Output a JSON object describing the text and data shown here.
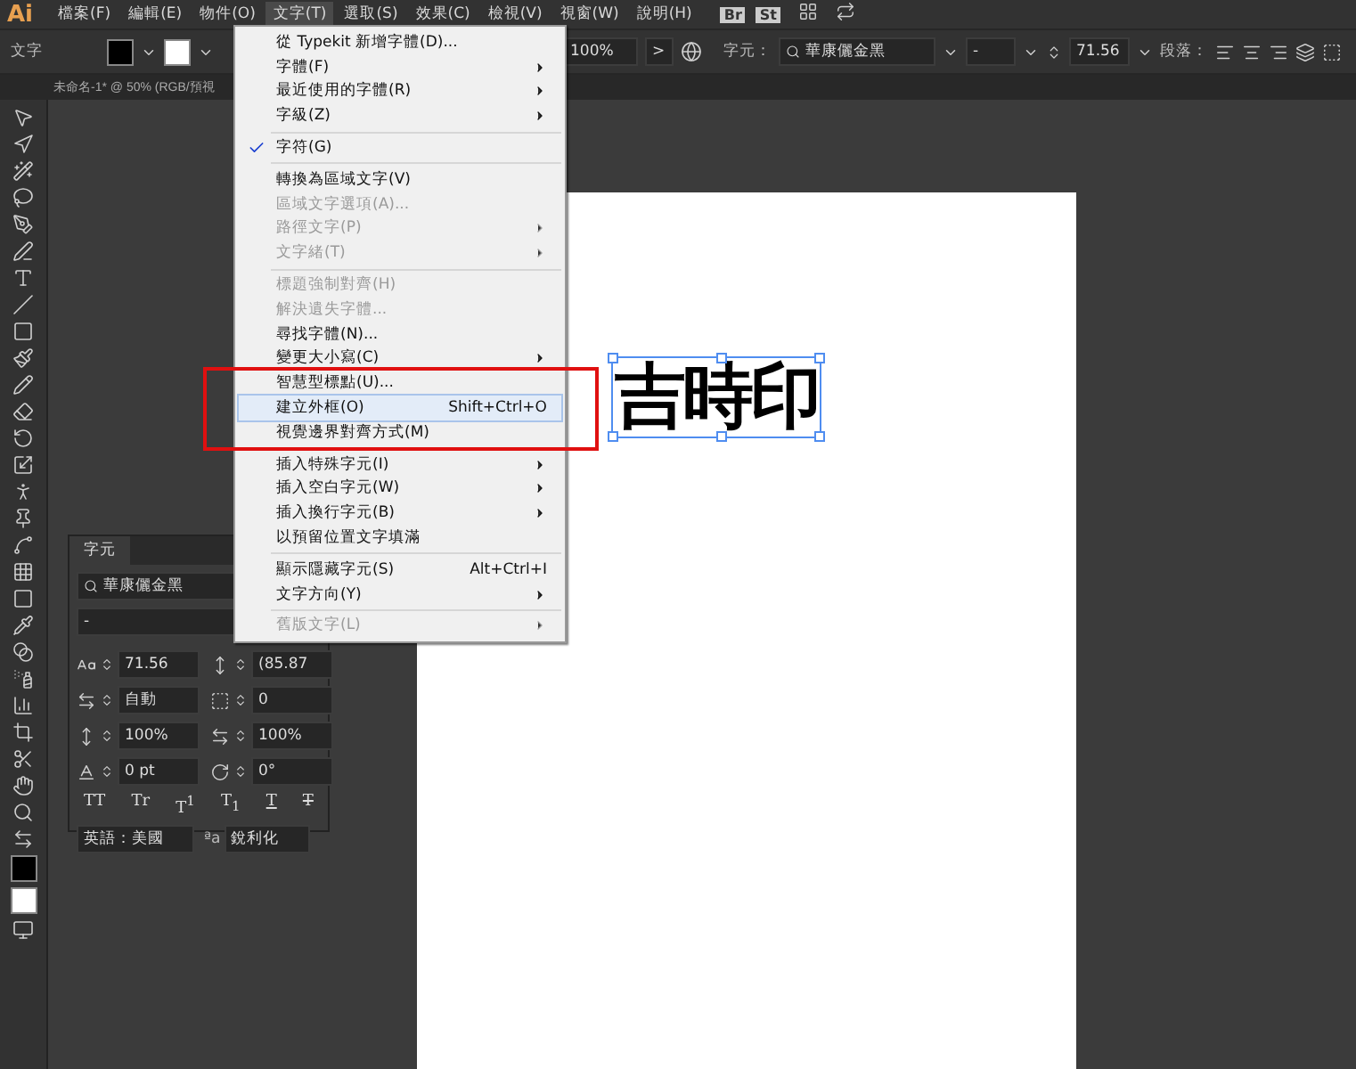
{
  "app_logo": "Ai",
  "menu_bar": [
    {
      "label": "檔案(F)",
      "selected": false
    },
    {
      "label": "編輯(E)",
      "selected": false
    },
    {
      "label": "物件(O)",
      "selected": false
    },
    {
      "label": "文字(T)",
      "selected": true
    },
    {
      "label": "選取(S)",
      "selected": false
    },
    {
      "label": "效果(C)",
      "selected": false
    },
    {
      "label": "檢視(V)",
      "selected": false
    },
    {
      "label": "視窗(W)",
      "selected": false
    },
    {
      "label": "說明(H)",
      "selected": false
    }
  ],
  "app_badges": [
    "Br",
    "St"
  ],
  "control_bar": {
    "tool_label": "文字",
    "opacity": "100%",
    "more": ">",
    "character_label": "字元：",
    "font": "華康儷金黑",
    "style": "-",
    "size": "71.56",
    "paragraph_label": "段落："
  },
  "document_tab": "未命名-1* @ 50% (RGB/預視",
  "artboard_text": "吉時印",
  "menu": [
    [
      {
        "label": "從 Typekit 新增字體(D)...",
        "submenu": false,
        "disabled": false,
        "checked": false,
        "selected": false
      },
      {
        "label": "字體(F)",
        "submenu": true,
        "disabled": false,
        "checked": false,
        "selected": false
      },
      {
        "label": "最近使用的字體(R)",
        "submenu": true,
        "disabled": false,
        "checked": false,
        "selected": false
      },
      {
        "label": "字級(Z)",
        "submenu": true,
        "disabled": false,
        "checked": false,
        "selected": false
      }
    ],
    [
      {
        "label": "字符(G)",
        "submenu": false,
        "disabled": false,
        "checked": true,
        "selected": false
      }
    ],
    [
      {
        "label": "轉換為區域文字(V)",
        "submenu": false,
        "disabled": false,
        "checked": false,
        "selected": false
      },
      {
        "label": "區域文字選項(A)...",
        "submenu": false,
        "disabled": true,
        "checked": false,
        "selected": false
      },
      {
        "label": "路徑文字(P)",
        "submenu": true,
        "disabled": true,
        "checked": false,
        "selected": false
      },
      {
        "label": "文字緒(T)",
        "submenu": true,
        "disabled": true,
        "checked": false,
        "selected": false
      }
    ],
    [
      {
        "label": "標題強制對齊(H)",
        "submenu": false,
        "disabled": true,
        "checked": false,
        "selected": false
      },
      {
        "label": "解決遺失字體...",
        "submenu": false,
        "disabled": true,
        "checked": false,
        "selected": false
      },
      {
        "label": "尋找字體(N)...",
        "submenu": false,
        "disabled": false,
        "checked": false,
        "selected": false
      },
      {
        "label": "變更大小寫(C)",
        "submenu": true,
        "disabled": false,
        "checked": false,
        "selected": false
      },
      {
        "label": "智慧型標點(U)...",
        "submenu": false,
        "disabled": false,
        "checked": false,
        "selected": false
      },
      {
        "label": "建立外框(O)",
        "shortcut": "Shift+Ctrl+O",
        "submenu": false,
        "disabled": false,
        "checked": false,
        "selected": true
      },
      {
        "label": "視覺邊界對齊方式(M)",
        "submenu": false,
        "disabled": false,
        "checked": false,
        "selected": false
      }
    ],
    [
      {
        "label": "插入特殊字元(I)",
        "submenu": true,
        "disabled": false,
        "checked": false,
        "selected": false
      },
      {
        "label": "插入空白字元(W)",
        "submenu": true,
        "disabled": false,
        "checked": false,
        "selected": false
      },
      {
        "label": "插入換行字元(B)",
        "submenu": true,
        "disabled": false,
        "checked": false,
        "selected": false
      },
      {
        "label": "以預留位置文字填滿",
        "submenu": false,
        "disabled": false,
        "checked": false,
        "selected": false
      }
    ],
    [
      {
        "label": "顯示隱藏字元(S)",
        "shortcut": "Alt+Ctrl+I",
        "submenu": false,
        "disabled": false,
        "checked": false,
        "selected": false
      },
      {
        "label": "文字方向(Y)",
        "submenu": true,
        "disabled": false,
        "checked": false,
        "selected": false
      }
    ],
    [
      {
        "label": "舊版文字(L)",
        "submenu": true,
        "disabled": true,
        "checked": false,
        "selected": false
      }
    ]
  ],
  "character_panel": {
    "title": "字元",
    "font": "華康儷金黑",
    "style": "-",
    "fields": [
      {
        "value": "71.56"
      },
      {
        "value": "(85.87"
      },
      {
        "value": "自動"
      },
      {
        "value": "0"
      },
      {
        "value": "100%"
      },
      {
        "value": "100%"
      },
      {
        "value": "0 pt"
      },
      {
        "value": "0°"
      }
    ],
    "style_buttons": [
      {
        "label": "TT",
        "kind": "plain"
      },
      {
        "label": "Tr",
        "kind": "plain"
      },
      {
        "label": "T$^{1}$",
        "kind": "plain"
      },
      {
        "label": "T$_{1}$",
        "kind": "plain"
      },
      {
        "label": "T",
        "kind": "underline"
      },
      {
        "label": "T",
        "kind": "strikethrough"
      }
    ],
    "language": "英語：美國",
    "antialias_icon": "ªa",
    "antialias": "銳利化"
  }
}
